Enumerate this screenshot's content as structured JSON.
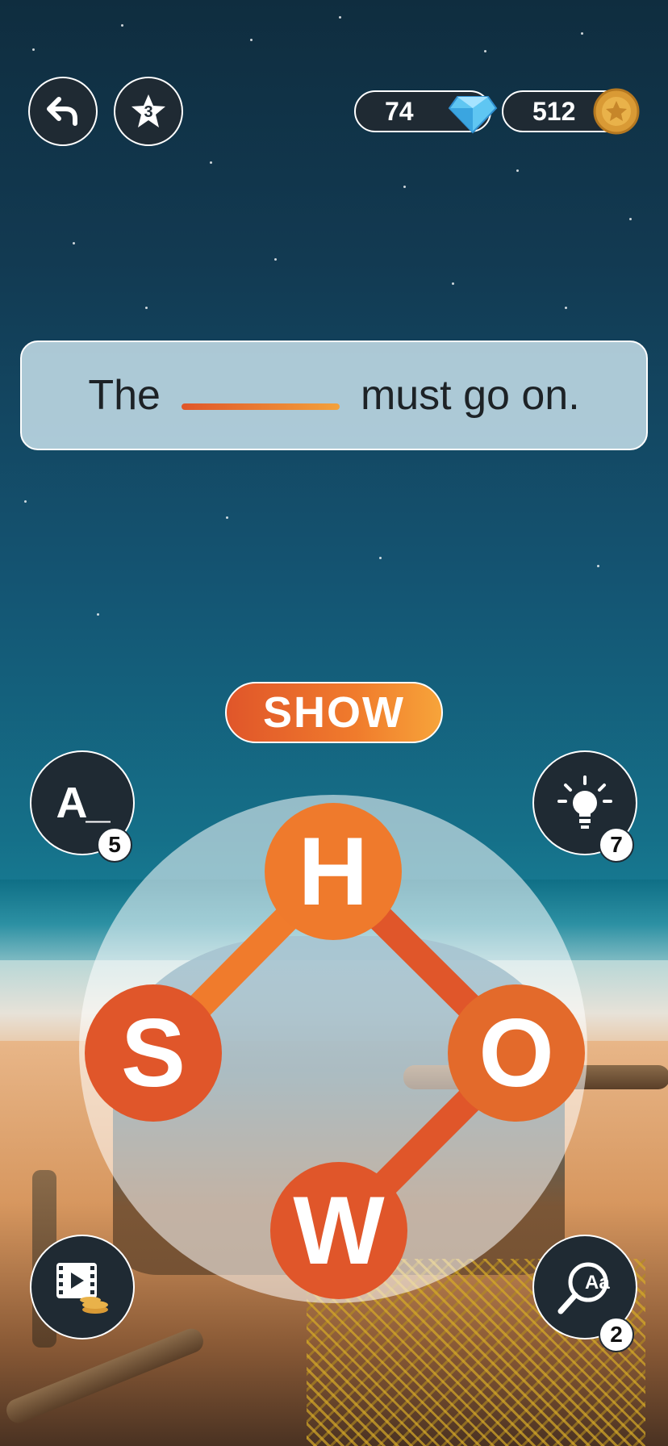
{
  "header": {
    "gems": "74",
    "coins": "512",
    "level_star": "3"
  },
  "clue": {
    "before": "The",
    "after": "must go on."
  },
  "current_word": "SHOW",
  "wheel": {
    "letters": [
      "H",
      "O",
      "W",
      "S"
    ]
  },
  "powerups": {
    "reveal_letter": {
      "label": "A_",
      "count": "5"
    },
    "hint": {
      "count": "7"
    },
    "lookup": {
      "label": "Aa",
      "count": "2"
    }
  },
  "colors": {
    "accent_start": "#e0562a",
    "accent_end": "#f7a43a",
    "button_bg": "#1f2a33"
  }
}
